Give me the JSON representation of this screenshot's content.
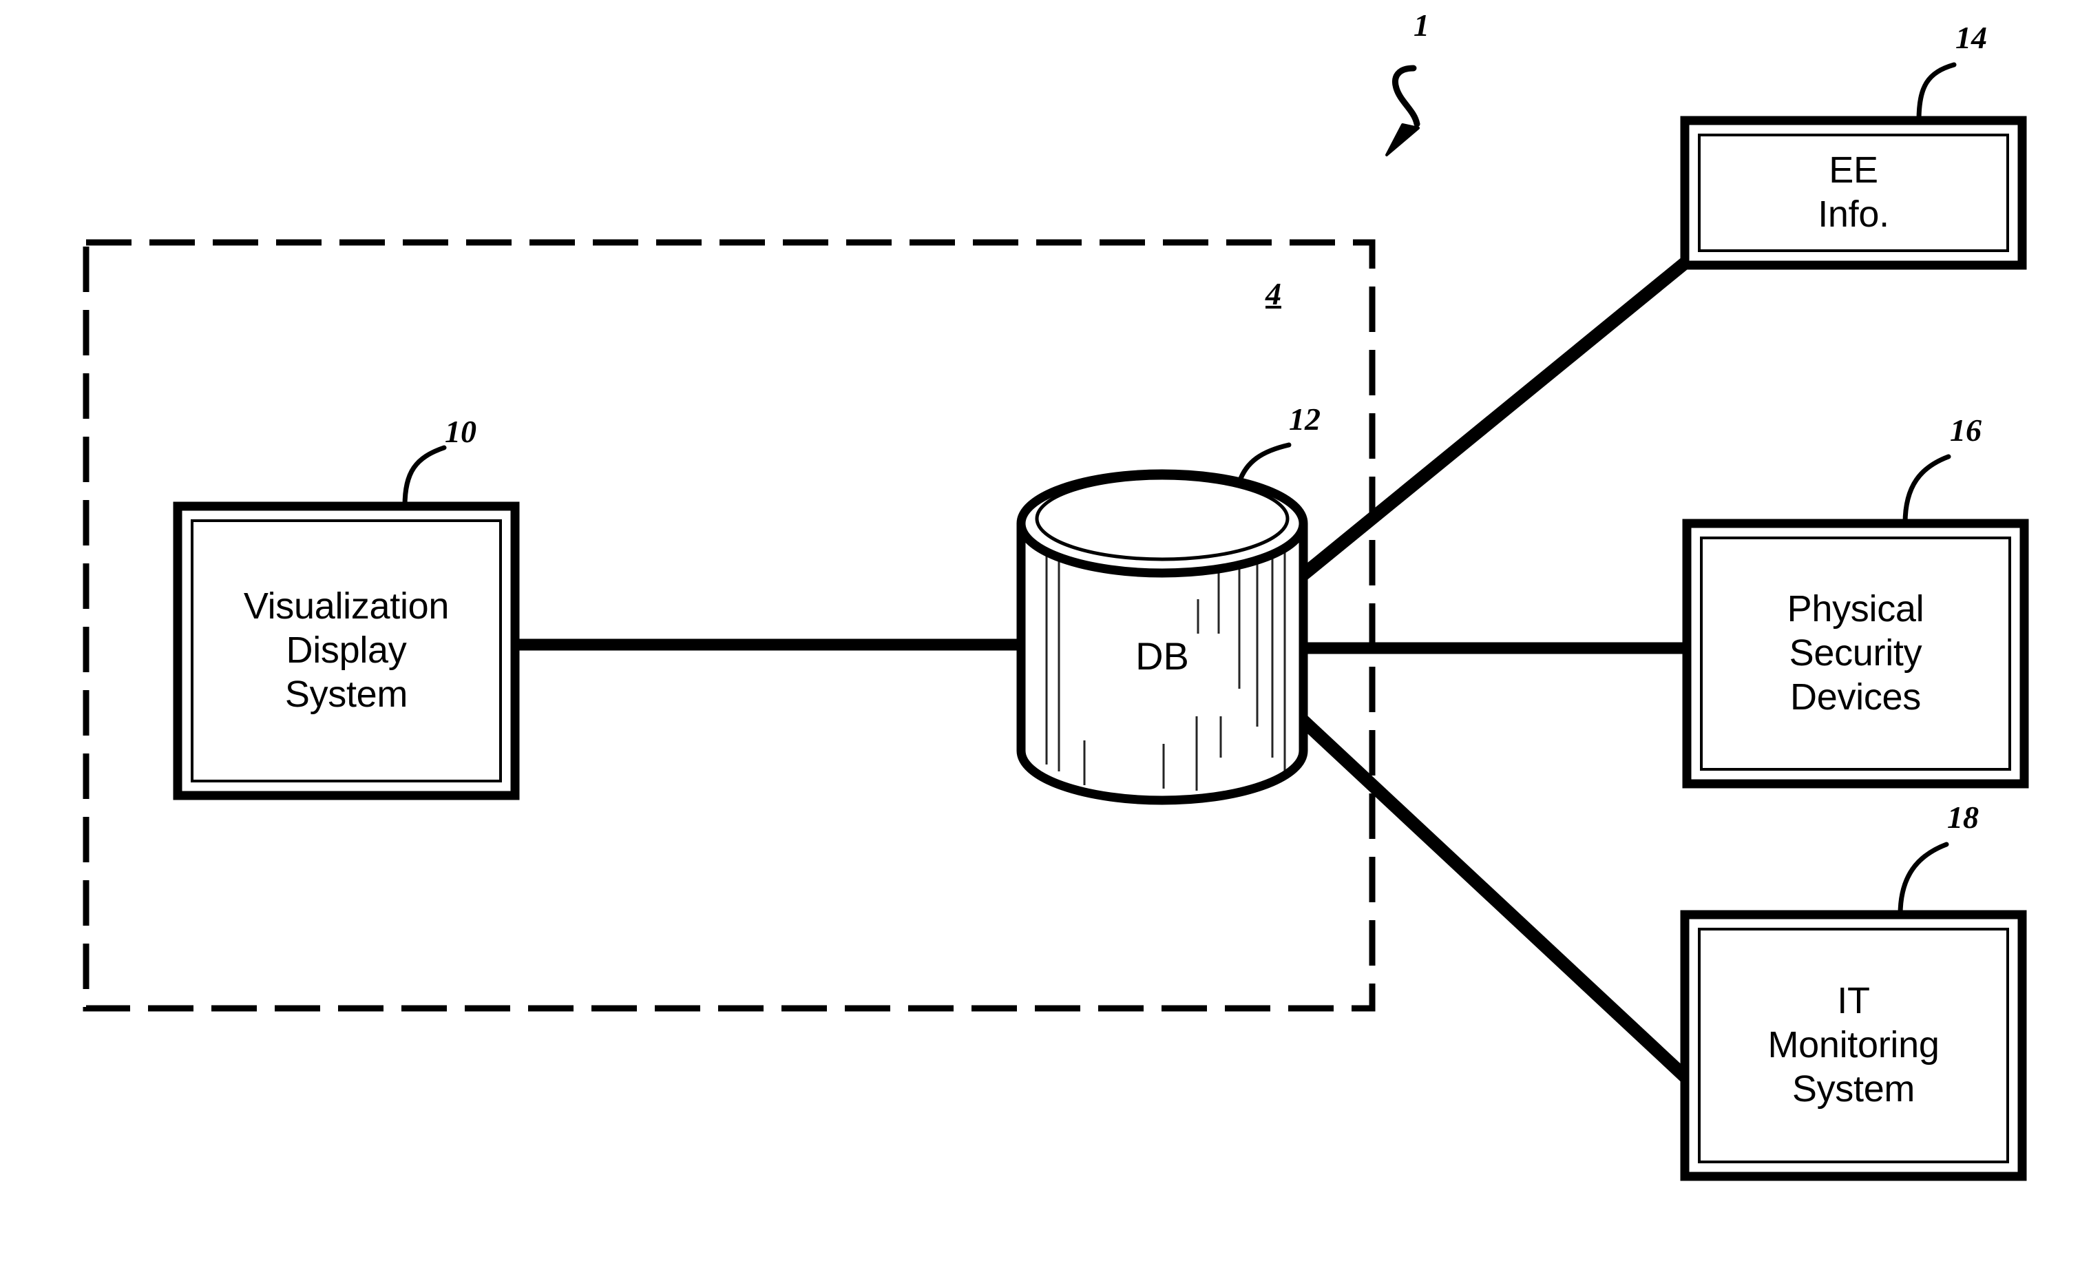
{
  "figure": {
    "figure_reference": "1",
    "system_boundary_reference": "4"
  },
  "nodes": {
    "visualization_display_system": {
      "label": "Visualization\nDisplay\nSystem",
      "reference": "10"
    },
    "database": {
      "label": "DB",
      "reference": "12"
    },
    "ee_info": {
      "label": "EE\nInfo.",
      "reference": "14"
    },
    "physical_security_devices": {
      "label": "Physical\nSecurity\nDevices",
      "reference": "16"
    },
    "it_monitoring_system": {
      "label": "IT\nMonitoring\nSystem",
      "reference": "18"
    }
  },
  "colors": {
    "ink": "#000000",
    "background": "#ffffff"
  }
}
